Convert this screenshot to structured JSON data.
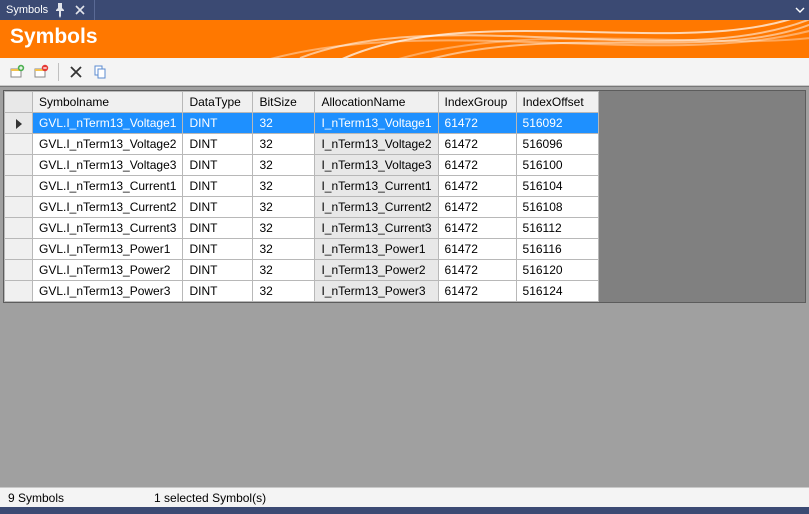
{
  "tab": {
    "title": "Symbols"
  },
  "header": {
    "title": "Symbols"
  },
  "columns": {
    "symbolname": "Symbolname",
    "datatype": "DataType",
    "bitsize": "BitSize",
    "allocation": "AllocationName",
    "indexgroup": "IndexGroup",
    "indexoffset": "IndexOffset"
  },
  "rows": [
    {
      "symbolname": "GVL.I_nTerm13_Voltage1",
      "datatype": "DINT",
      "bitsize": "32",
      "allocation": "I_nTerm13_Voltage1",
      "indexgroup": "61472",
      "indexoffset": "516092",
      "selected": true
    },
    {
      "symbolname": "GVL.I_nTerm13_Voltage2",
      "datatype": "DINT",
      "bitsize": "32",
      "allocation": "I_nTerm13_Voltage2",
      "indexgroup": "61472",
      "indexoffset": "516096",
      "selected": false
    },
    {
      "symbolname": "GVL.I_nTerm13_Voltage3",
      "datatype": "DINT",
      "bitsize": "32",
      "allocation": "I_nTerm13_Voltage3",
      "indexgroup": "61472",
      "indexoffset": "516100",
      "selected": false
    },
    {
      "symbolname": "GVL.I_nTerm13_Current1",
      "datatype": "DINT",
      "bitsize": "32",
      "allocation": "I_nTerm13_Current1",
      "indexgroup": "61472",
      "indexoffset": "516104",
      "selected": false
    },
    {
      "symbolname": "GVL.I_nTerm13_Current2",
      "datatype": "DINT",
      "bitsize": "32",
      "allocation": "I_nTerm13_Current2",
      "indexgroup": "61472",
      "indexoffset": "516108",
      "selected": false
    },
    {
      "symbolname": "GVL.I_nTerm13_Current3",
      "datatype": "DINT",
      "bitsize": "32",
      "allocation": "I_nTerm13_Current3",
      "indexgroup": "61472",
      "indexoffset": "516112",
      "selected": false
    },
    {
      "symbolname": "GVL.I_nTerm13_Power1",
      "datatype": "DINT",
      "bitsize": "32",
      "allocation": "I_nTerm13_Power1",
      "indexgroup": "61472",
      "indexoffset": "516116",
      "selected": false
    },
    {
      "symbolname": "GVL.I_nTerm13_Power2",
      "datatype": "DINT",
      "bitsize": "32",
      "allocation": "I_nTerm13_Power2",
      "indexgroup": "61472",
      "indexoffset": "516120",
      "selected": false
    },
    {
      "symbolname": "GVL.I_nTerm13_Power3",
      "datatype": "DINT",
      "bitsize": "32",
      "allocation": "I_nTerm13_Power3",
      "indexgroup": "61472",
      "indexoffset": "516124",
      "selected": false
    }
  ],
  "status": {
    "count": "9 Symbols",
    "selection": "1 selected Symbol(s)"
  }
}
